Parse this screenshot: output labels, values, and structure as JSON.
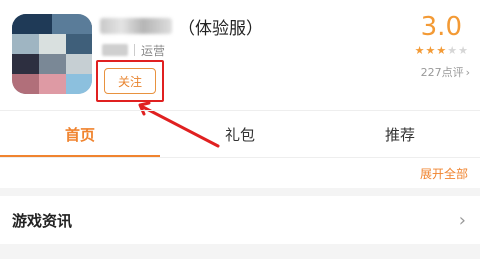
{
  "app": {
    "name_suffix": "（体验服）",
    "developer_role": "运营",
    "follow_label": "关注",
    "score": "3.0",
    "rating_stars": 3,
    "max_stars": 5,
    "review_count": "227",
    "review_suffix": "点评",
    "review_chevron": "›"
  },
  "tabs": [
    {
      "label": "首页",
      "active": true
    },
    {
      "label": "礼包",
      "active": false
    },
    {
      "label": "推荐",
      "active": false
    }
  ],
  "expand_label": "展开全部",
  "section": {
    "title": "游戏资讯",
    "chevron": "›"
  },
  "colors": {
    "accent": "#f0842f",
    "annotation": "#e02020"
  }
}
